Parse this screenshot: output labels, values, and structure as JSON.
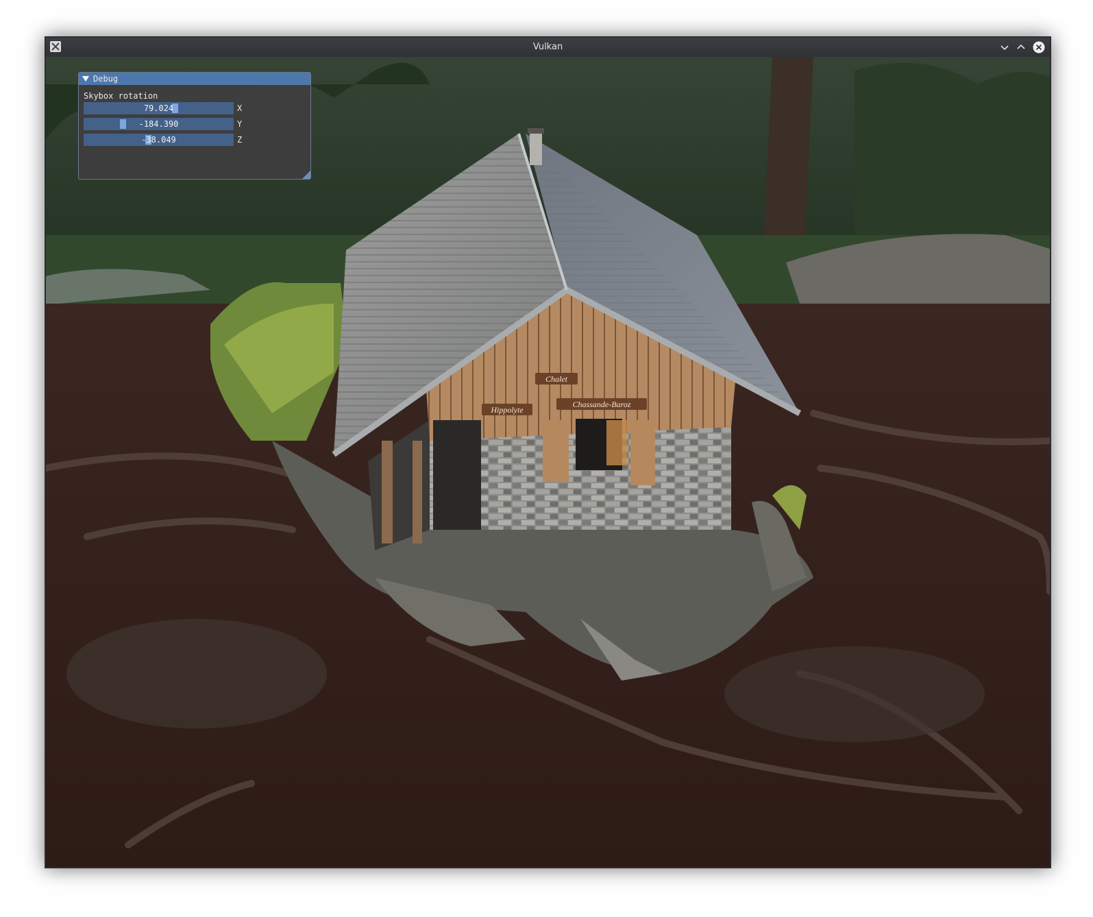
{
  "window": {
    "title": "Vulkan"
  },
  "titlebar_icons": [
    "x-app-icon",
    "minimize-chevron-icon",
    "maximize-chevron-icon",
    "close-circle-icon"
  ],
  "debug": {
    "title": "Debug",
    "section": "Skybox rotation",
    "sliders": [
      {
        "axis": "X",
        "value": "79.024",
        "position": 0.615
      },
      {
        "axis": "Y",
        "value": "-184.390",
        "position": 0.25
      },
      {
        "axis": "Z",
        "value": "-38.049",
        "position": 0.43
      }
    ]
  },
  "scene": {
    "sign_chalet": "Chalet",
    "sign_left": "Hippolyte",
    "sign_right": "Chassande-Baroz"
  },
  "colors": {
    "header": "#4e78ad",
    "slider": "#44618a",
    "grab": "#7ea7e0",
    "titlebar": "#35383c"
  }
}
